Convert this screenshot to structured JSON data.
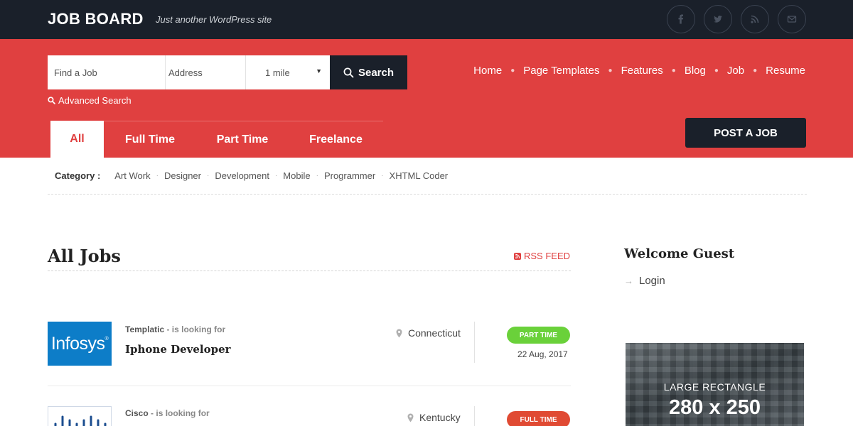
{
  "header": {
    "brand": "JOB BOARD",
    "tagline": "Just another WordPress site",
    "social_icons": [
      "facebook-icon",
      "twitter-icon",
      "rss-icon",
      "email-icon"
    ]
  },
  "search": {
    "job_placeholder": "Find a Job",
    "address_placeholder": "Address",
    "radius_value": "1 mile",
    "button_label": "Search",
    "advanced_label": "Advanced Search"
  },
  "nav": {
    "items": [
      "Home",
      "Page Templates",
      "Features",
      "Blog",
      "Job",
      "Resume"
    ]
  },
  "tabs": [
    "All",
    "Full Time",
    "Part Time",
    "Freelance"
  ],
  "post_job_label": "POST A JOB",
  "categories": {
    "label": "Category :",
    "items": [
      "Art Work",
      "Designer",
      "Development",
      "Mobile",
      "Programmer",
      "XHTML Coder"
    ]
  },
  "jobs": {
    "heading": "All Jobs",
    "rss_label": "RSS FEED",
    "list": [
      {
        "logo_text": "Infosys",
        "company": "Templatic",
        "looking": "- is looking for",
        "title": "Iphone Developer",
        "location": "Connecticut",
        "type": "PART TIME",
        "date": "22 Aug, 2017"
      },
      {
        "logo_text": "",
        "company": "Cisco",
        "looking": "- is looking for",
        "title": "",
        "location": "Kentucky",
        "type": "FULL TIME",
        "date": ""
      }
    ]
  },
  "sidebar": {
    "welcome": "Welcome Guest",
    "login_label": "Login",
    "ad_line1": "LARGE RECTANGLE",
    "ad_line2": "280 x 250"
  },
  "colors": {
    "brand_red": "#e04040",
    "dark": "#1a202a",
    "part_time_badge": "#6ad13a",
    "full_time_badge": "#e04a33",
    "infosys_blue": "#0d7dc8"
  }
}
